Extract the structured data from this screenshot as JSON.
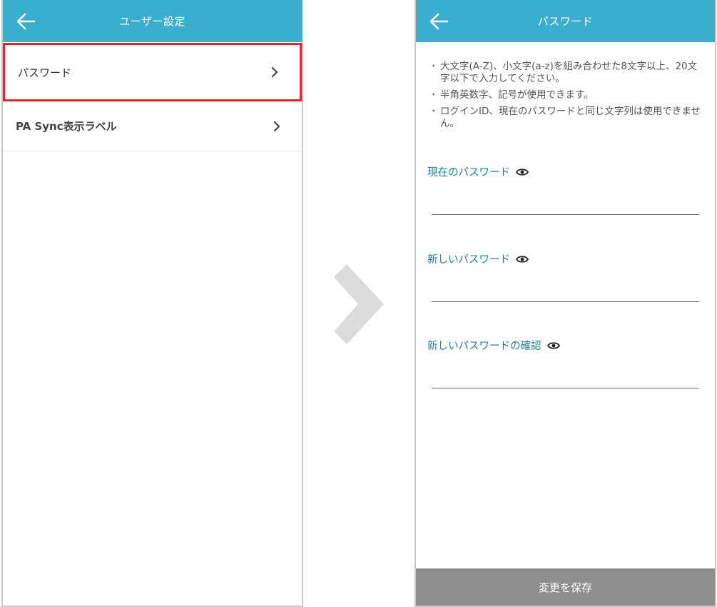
{
  "colors": {
    "appbar": "#3aaecc",
    "highlight_border": "#e0262f",
    "field_label": "#1f7f96",
    "save_bar": "#8e8e8e",
    "transition_arrow": "#dcdcdc"
  },
  "left_screen": {
    "header": {
      "back_icon": "arrow-left-icon",
      "title": "ユーザー設定"
    },
    "items": [
      {
        "label": "パスワード",
        "icon": "chevron-right-icon",
        "highlighted": true
      },
      {
        "label": "PA Sync表示ラベル",
        "icon": "chevron-right-icon",
        "highlighted": false
      }
    ]
  },
  "transition": {
    "icon": "chevron-right-icon"
  },
  "right_screen": {
    "header": {
      "back_icon": "arrow-left-icon",
      "title": "パスワード"
    },
    "rules": [
      "大文字(A-Z)、小文字(a-z)を組み合わせた8文字以上、20文字以下で入力してください。",
      "半角英数字、記号が使用できます。",
      "ログインID、現在のパスワードと同じ文字列は使用できません。"
    ],
    "fields": [
      {
        "label": "現在のパスワード",
        "value": "",
        "icon": "eye-icon"
      },
      {
        "label": "新しいパスワード",
        "value": "",
        "icon": "eye-icon"
      },
      {
        "label": "新しいパスワードの確認",
        "value": "",
        "icon": "eye-icon"
      }
    ],
    "save_button": "変更を保存"
  }
}
